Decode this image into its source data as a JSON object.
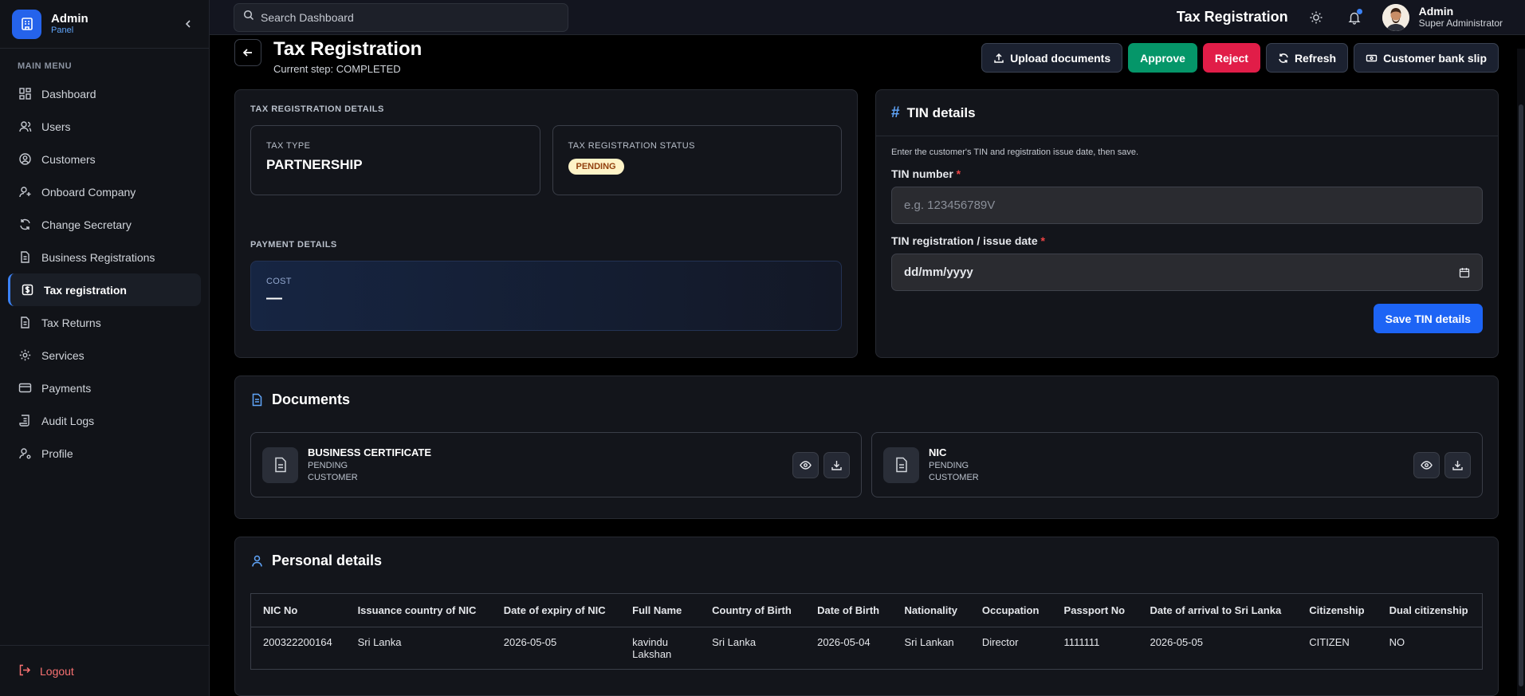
{
  "brand": {
    "title": "Admin",
    "subtitle": "Panel"
  },
  "sidebar": {
    "section": "MAIN MENU",
    "items": [
      {
        "label": "Dashboard",
        "icon": "dashboard-icon"
      },
      {
        "label": "Users",
        "icon": "user-icon"
      },
      {
        "label": "Customers",
        "icon": "customer-icon"
      },
      {
        "label": "Onboard Company",
        "icon": "user-plus-icon"
      },
      {
        "label": "Change Secretary",
        "icon": "refresh-icon"
      },
      {
        "label": "Business Registrations",
        "icon": "document-icon"
      },
      {
        "label": "Tax registration",
        "icon": "dollar-icon"
      },
      {
        "label": "Tax Returns",
        "icon": "document-icon"
      },
      {
        "label": "Services",
        "icon": "gear-icon"
      },
      {
        "label": "Payments",
        "icon": "card-icon"
      },
      {
        "label": "Audit Logs",
        "icon": "scroll-icon"
      },
      {
        "label": "Profile",
        "icon": "user-gear-icon"
      }
    ],
    "active_item": "Tax registration",
    "logout": "Logout"
  },
  "topbar": {
    "search_placeholder": "Search Dashboard",
    "title": "Tax Registration",
    "user_name": "Admin",
    "user_role": "Super Administrator"
  },
  "page": {
    "title": "Tax Registration",
    "step": "Current step: COMPLETED",
    "actions": {
      "upload": "Upload documents",
      "approve": "Approve",
      "reject": "Reject",
      "refresh": "Refresh",
      "bank_slip": "Customer bank slip"
    }
  },
  "tax_details": {
    "section": "TAX REGISTRATION DETAILS",
    "type_label": "TAX TYPE",
    "type_value": "PARTNERSHIP",
    "status_label": "TAX REGISTRATION STATUS",
    "status_value": "PENDING",
    "payment_section": "PAYMENT DETAILS",
    "cost_label": "COST",
    "cost_value": "—"
  },
  "tin": {
    "title": "TIN details",
    "help": "Enter the customer's TIN and registration issue date, then save.",
    "number_label": "TIN number",
    "number_placeholder": "e.g. 123456789V",
    "number_value": "",
    "date_label": "TIN registration / issue date",
    "date_placeholder": "dd/mm/yyyy",
    "required_mark": "*",
    "save": "Save TIN details"
  },
  "documents": {
    "title": "Documents",
    "items": [
      {
        "name": "BUSINESS CERTIFICATE",
        "status": "PENDING",
        "owner": "CUSTOMER"
      },
      {
        "name": "NIC",
        "status": "PENDING",
        "owner": "CUSTOMER"
      }
    ]
  },
  "personal": {
    "title": "Personal details",
    "columns": [
      "NIC No",
      "Issuance country of NIC",
      "Date of expiry of NIC",
      "Full Name",
      "Country of Birth",
      "Date of Birth",
      "Nationality",
      "Occupation",
      "Passport No",
      "Date of arrival to Sri Lanka",
      "Citizenship",
      "Dual citizenship"
    ],
    "rows": [
      [
        "200322200164",
        "Sri Lanka",
        "2026-05-05",
        "kavindu Lakshan",
        "Sri Lanka",
        "2026-05-04",
        "Sri Lankan",
        "Director",
        "1111111",
        "2026-05-05",
        "CITIZEN",
        "NO"
      ]
    ]
  },
  "colors": {
    "accent": "#2563eb",
    "approve": "#059669",
    "reject": "#e11d48",
    "pending_bg": "#fef3c7"
  }
}
